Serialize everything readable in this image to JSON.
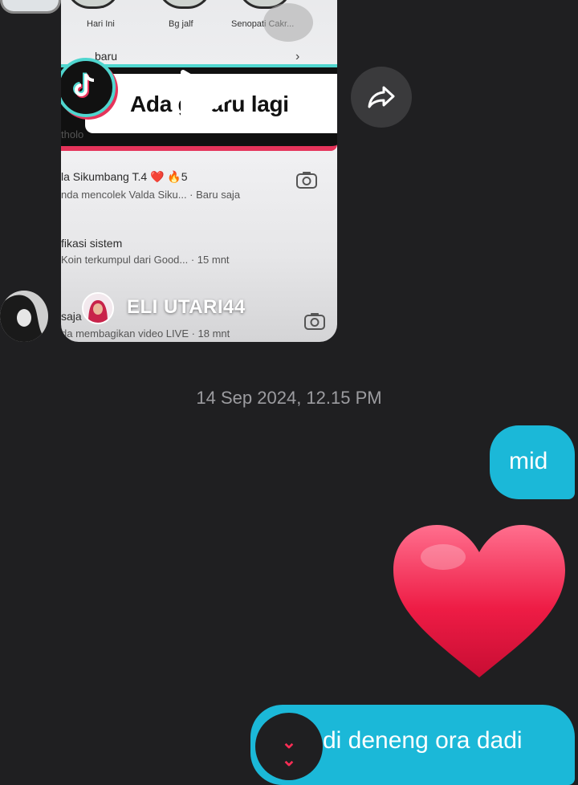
{
  "video_card": {
    "stories": [
      "Hari Ini",
      "Bg jalf",
      "Senopati Cakr..."
    ],
    "section_label": "baru",
    "banner_text": "Ada  g baru lagi",
    "partial_text": "tholo",
    "notifications": [
      {
        "title": "la Sikumbang T.4 ❤️ 🔥5",
        "subtitle": "nda mencolek Valda Siku... · Baru saja"
      },
      {
        "title": "fikasi sistem",
        "subtitle": "Koin terkumpul dari Good... · 15 mnt"
      },
      {
        "title": "saja",
        "subtitle": "da membagikan video LIVE · 18 mnt"
      }
    ],
    "sender_username": "ELI UTARI44"
  },
  "timestamp": "14 Sep 2024, 12.15 PM",
  "messages": [
    {
      "text": "mid"
    },
    {
      "text": "di deneng ora dadi"
    }
  ],
  "colors": {
    "background": "#1f1f21",
    "bubble": "#1bb8d8",
    "accent_red": "#ff2d55"
  }
}
